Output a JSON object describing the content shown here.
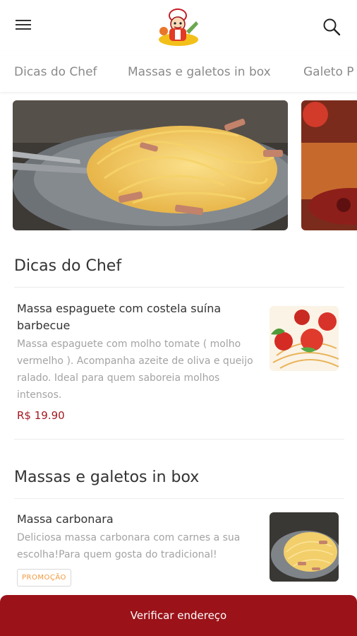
{
  "header": {
    "menu_icon": "hamburger-menu-icon",
    "logo_icon": "chef-mascot-logo",
    "search_icon": "search-icon"
  },
  "tabs": [
    {
      "label": "Dicas do Chef"
    },
    {
      "label": "Massas e galetos in box"
    },
    {
      "label": "Galeto P"
    }
  ],
  "sections": [
    {
      "title": "Dicas do Chef",
      "items": [
        {
          "name": "Massa espaguete com costela suína barbecue",
          "description": "Massa espaguete com molho tomate ( molho vermelho ). Acompanha azeite de oliva e queijo ralado. Ideal para quem saboreia molhos intensos.",
          "price": "R$ 19.90"
        }
      ]
    },
    {
      "title": "Massas e galetos in box",
      "items": [
        {
          "name": "Massa carbonara",
          "description": "Deliciosa massa carbonara com carnes a sua escolha!Para quem gosta do tradicional!",
          "badge": "PROMOÇÃO"
        }
      ]
    }
  ],
  "footer": {
    "cta_label": "Verificar endereço"
  },
  "colors": {
    "brand": "#9b1219",
    "price": "#a3191f",
    "promo": "#f19a3e"
  }
}
